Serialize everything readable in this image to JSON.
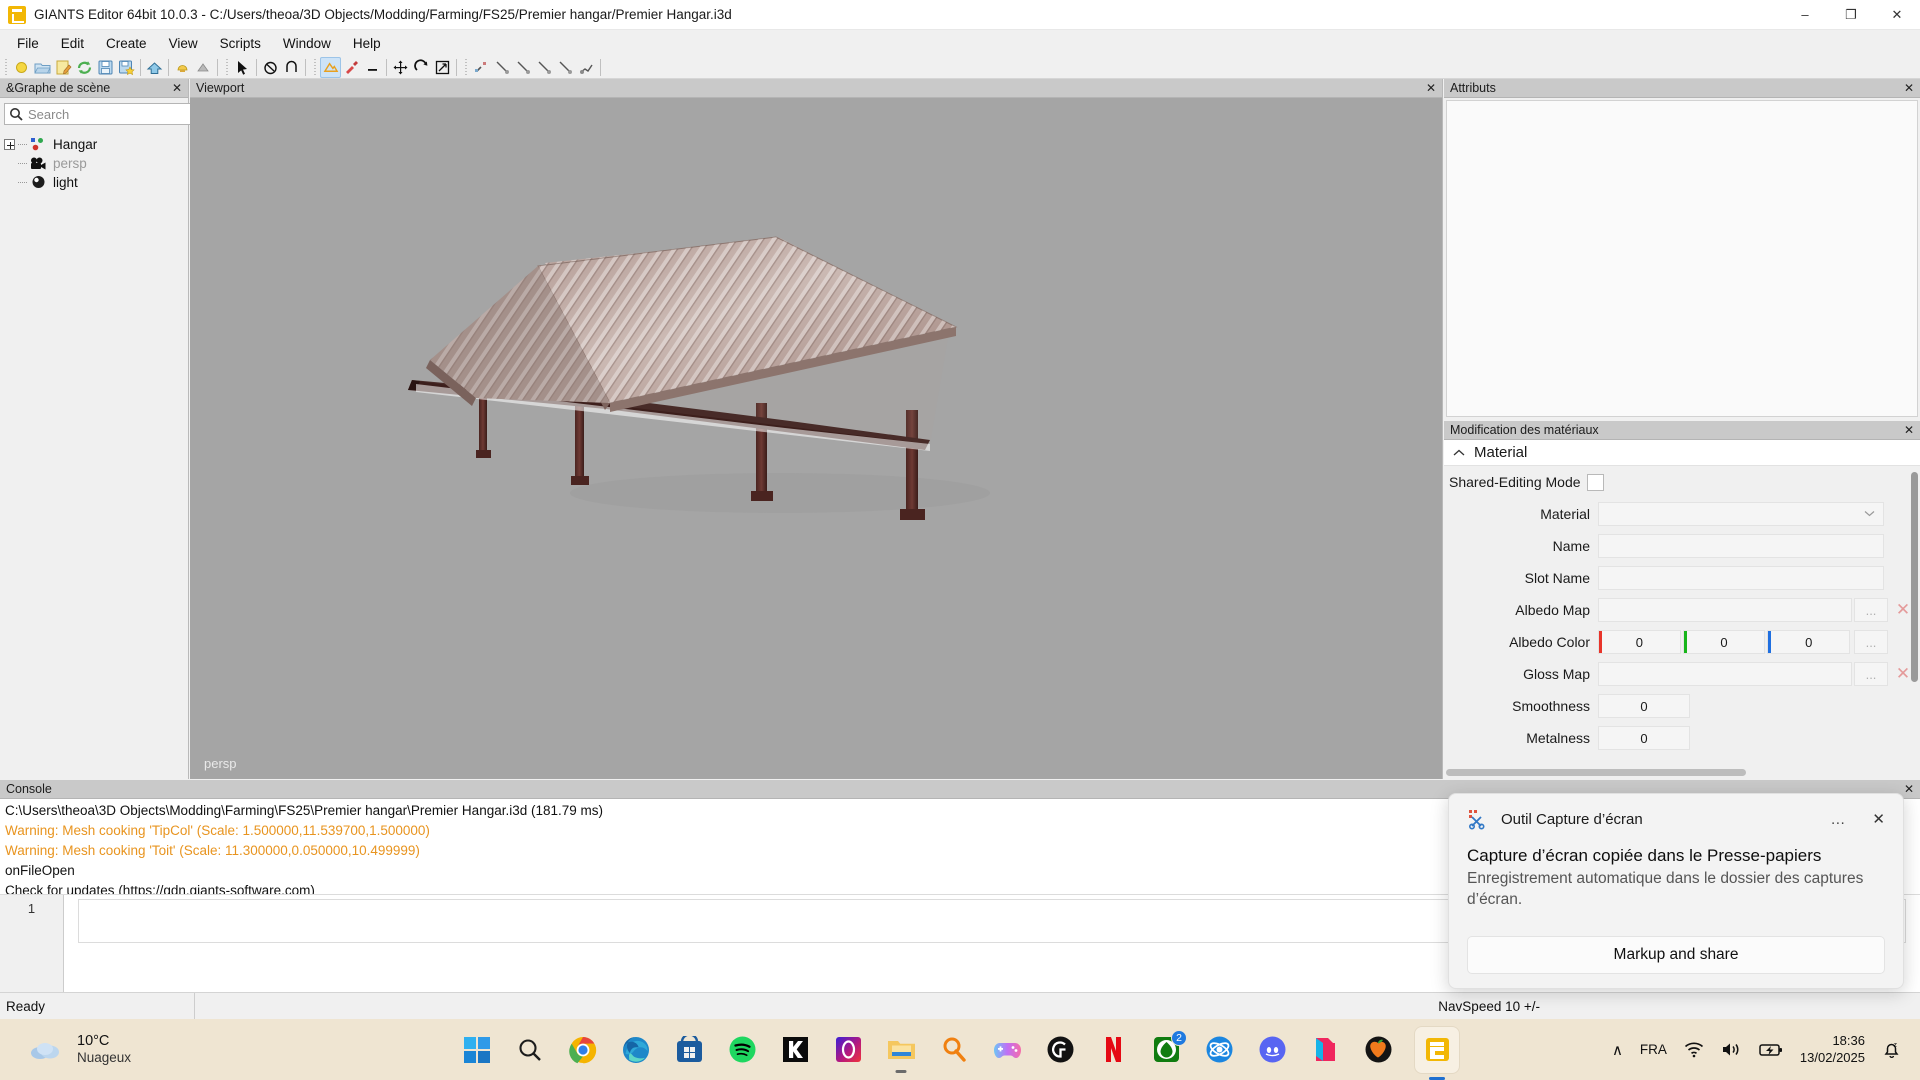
{
  "window": {
    "title": "GIANTS Editor 64bit 10.0.3 - C:/Users/theoa/3D Objects/Modding/Farming/FS25/Premier hangar/Premier Hangar.i3d",
    "minimize": "–",
    "maximize": "❐",
    "close": "✕"
  },
  "menubar": {
    "items": [
      "File",
      "Edit",
      "Create",
      "View",
      "Scripts",
      "Window",
      "Help"
    ]
  },
  "scenegraph": {
    "title": "&Graphe de scène",
    "close": "✕",
    "search": {
      "value": "",
      "placeholder": "Search",
      "clear": "✕"
    },
    "nodes": [
      {
        "label": "Hangar",
        "icon": "transform-group-icon",
        "dim": false,
        "expandable": true
      },
      {
        "label": "persp",
        "icon": "camera-icon",
        "dim": true,
        "expandable": false
      },
      {
        "label": "light",
        "icon": "light-icon",
        "dim": false,
        "expandable": false
      }
    ]
  },
  "viewport": {
    "title": "Viewport",
    "close": "✕",
    "camera_label": "persp"
  },
  "attributes": {
    "title": "Attributs",
    "close": "✕"
  },
  "material_panel": {
    "title": "Modification des matériaux",
    "close": "✕",
    "section": "Material",
    "rows": [
      {
        "label": "Shared-Editing Mode",
        "type": "checkbox",
        "checked": false
      },
      {
        "label": "Material",
        "type": "combo",
        "value": ""
      },
      {
        "label": "Name",
        "type": "text",
        "value": ""
      },
      {
        "label": "Slot Name",
        "type": "text",
        "value": ""
      },
      {
        "label": "Albedo Map",
        "type": "file",
        "value": "",
        "browse": "...",
        "clear": "✕"
      },
      {
        "label": "Albedo Color",
        "type": "rgb",
        "r": "0",
        "g": "0",
        "b": "0",
        "browse": "..."
      },
      {
        "label": "Gloss Map",
        "type": "file",
        "value": "",
        "browse": "...",
        "clear": "✕"
      },
      {
        "label": "Smoothness",
        "type": "number",
        "value": "0"
      },
      {
        "label": "Metalness",
        "type": "number",
        "value": "0"
      }
    ],
    "color_bars": {
      "r": "#e8342a",
      "g": "#17b51a",
      "b": "#1f6fe0"
    }
  },
  "console": {
    "title": "Console",
    "close": "✕",
    "lines": [
      {
        "text": "C:\\Users\\theoa\\3D Objects\\Modding\\Farming\\FS25\\Premier hangar\\Premier Hangar.i3d (181.79 ms)",
        "warn": false
      },
      {
        "text": "Warning: Mesh cooking 'TipCol' (Scale: 1.500000,11.539700,1.500000)",
        "warn": true
      },
      {
        "text": "Warning: Mesh cooking 'Toit' (Scale: 11.300000,0.050000,10.499999)",
        "warn": true
      },
      {
        "text": "onFileOpen",
        "warn": false
      },
      {
        "text": "Check for updates (https://gdn.giants-software.com)",
        "warn": false
      }
    ],
    "line_number": "1",
    "input_value": ""
  },
  "statusbar": {
    "status": "Ready",
    "navspeed": "NavSpeed 10 +/-"
  },
  "toast": {
    "app": "Outil Capture d’écran",
    "icon": "snipping-tool-icon",
    "more": "…",
    "close": "✕",
    "title": "Capture d’écran copiée dans le Presse-papiers",
    "subtitle": "Enregistrement automatique dans le dossier des captures d’écran.",
    "button": "Markup and share"
  },
  "taskbar": {
    "weather": {
      "temp": "10°C",
      "desc": "Nuageux",
      "icon": "cloud-icon"
    },
    "apps": [
      {
        "name": "start-button",
        "label": "Start"
      },
      {
        "name": "search-icon",
        "label": "Search"
      },
      {
        "name": "chrome-icon",
        "label": "Google Chrome"
      },
      {
        "name": "edge-icon",
        "label": "Microsoft Edge"
      },
      {
        "name": "microsoft-store-icon",
        "label": "Microsoft Store"
      },
      {
        "name": "spotify-icon",
        "label": "Spotify"
      },
      {
        "name": "kick-icon",
        "label": "Kick"
      },
      {
        "name": "opera-gx-icon",
        "label": "Opera GX"
      },
      {
        "name": "file-explorer-icon",
        "label": "File Explorer"
      },
      {
        "name": "everything-icon",
        "label": "Everything"
      },
      {
        "name": "controller-icon",
        "label": "Controller App"
      },
      {
        "name": "logitech-g-icon",
        "label": "Logitech G HUB"
      },
      {
        "name": "netflix-icon",
        "label": "Netflix"
      },
      {
        "name": "xbox-icon",
        "label": "Xbox",
        "badge": "2"
      },
      {
        "name": "epic-games-icon",
        "label": "Epic Games"
      },
      {
        "name": "discord-icon",
        "label": "Discord"
      },
      {
        "name": "blender-like-icon",
        "label": "App"
      },
      {
        "name": "fl-studio-icon",
        "label": "FL Studio"
      },
      {
        "name": "giants-editor-icon",
        "label": "GIANTS Editor"
      }
    ],
    "tray": {
      "chevron": "∧",
      "language": "FRA",
      "wifi": "wifi-icon",
      "volume": "volume-icon",
      "battery": "battery-charging-icon",
      "time": "18:36",
      "date": "13/02/2025",
      "notifications": "bell-dnd-icon"
    }
  }
}
